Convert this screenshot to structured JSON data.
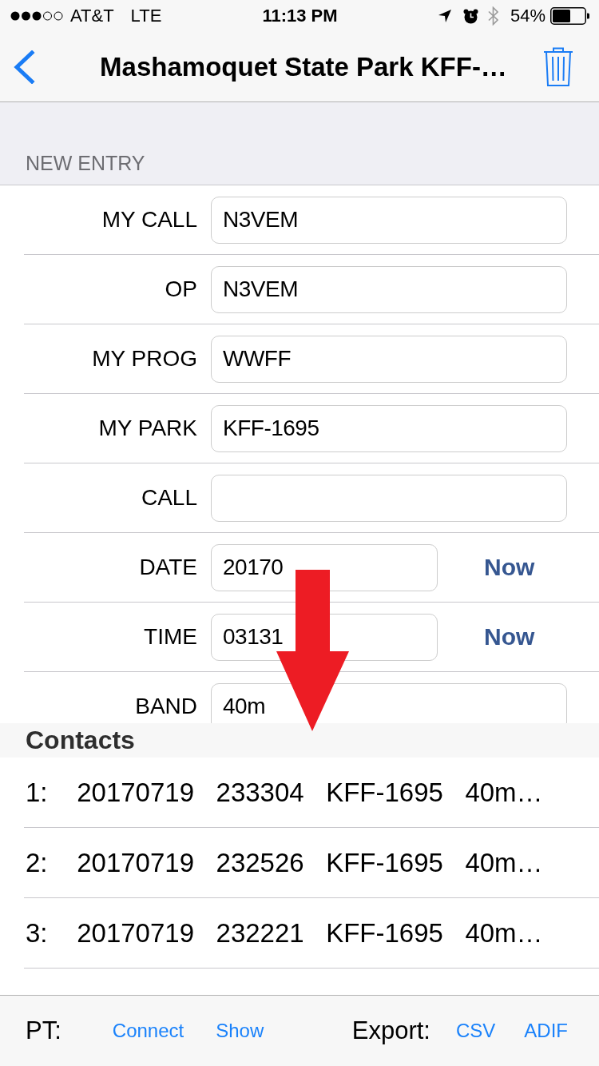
{
  "status_bar": {
    "carrier": "AT&T",
    "network": "LTE",
    "time": "11:13 PM",
    "battery": "54%"
  },
  "nav_bar": {
    "title": "Mashamoquet State Park KFF-…"
  },
  "new_entry": {
    "header": "NEW ENTRY",
    "fields": [
      {
        "kind": "text",
        "label": "MY CALL",
        "value": "N3VEM"
      },
      {
        "kind": "text",
        "label": "OP",
        "value": "N3VEM"
      },
      {
        "kind": "text",
        "label": "MY PROG",
        "value": "WWFF"
      },
      {
        "kind": "text",
        "label": "MY PARK",
        "value": "KFF-1695"
      },
      {
        "kind": "text",
        "label": "CALL"
      },
      {
        "kind": "text_with_button",
        "label": "DATE",
        "value": "20170",
        "button": "Now"
      },
      {
        "kind": "text_with_button",
        "label": "TIME",
        "value": "03131",
        "button": "Now"
      },
      {
        "kind": "text",
        "label": "BAND",
        "value": "40m"
      }
    ]
  },
  "contacts": {
    "header": "Contacts",
    "rows": [
      "1:    20170719   233304   KFF-1695   40m…",
      "2:    20170719   232526   KFF-1695   40m…",
      "3:    20170719   232221   KFF-1695   40m…"
    ]
  },
  "toolbar": {
    "pt_label": "PT:",
    "pt_buttons": [
      "Connect",
      "Show"
    ],
    "export_label": "Export:",
    "export_buttons": [
      "CSV",
      "ADIF"
    ]
  }
}
